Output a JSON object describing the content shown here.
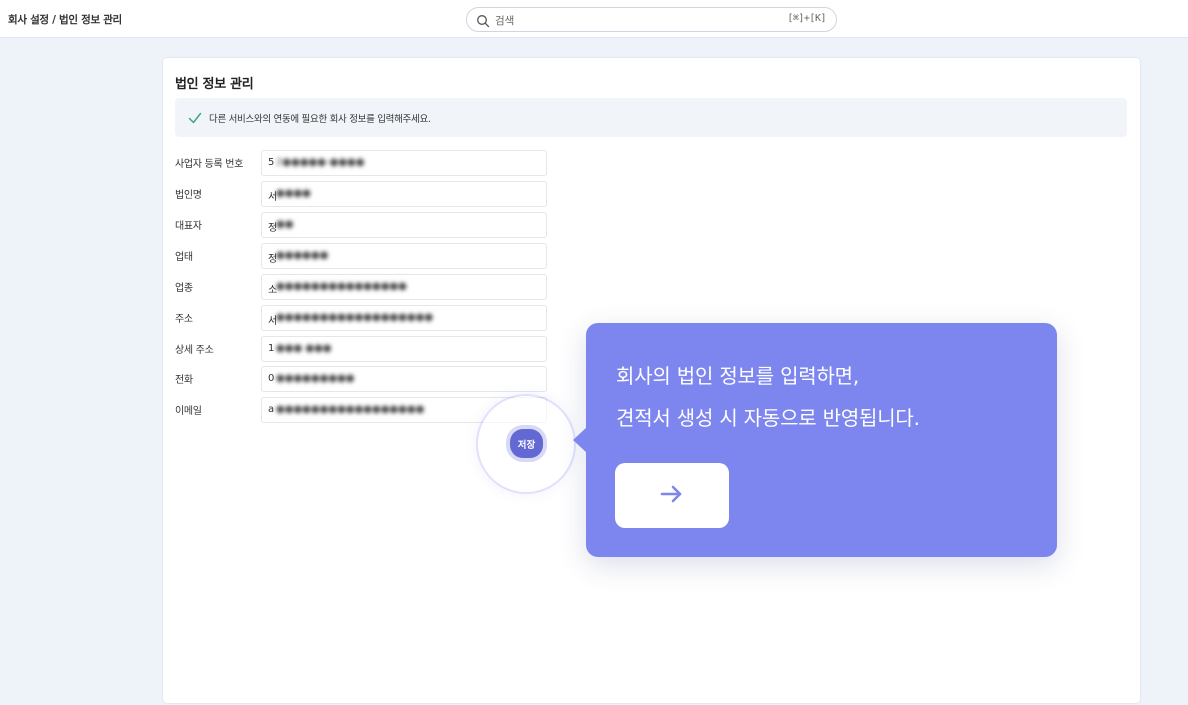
{
  "header": {
    "breadcrumb": "회사 설정 / 법인 정보 관리",
    "search": {
      "icon": "search-icon",
      "placeholder": "검색",
      "shortcut": "[⌘]+[K]"
    }
  },
  "main": {
    "title": "법인 정보 관리",
    "notice": {
      "icon": "check-icon",
      "text": "다른 서비스와의 연동에 필요한 회사 정보를 입력해주세요."
    },
    "fields": [
      {
        "label": "사업자 등록 번호",
        "first_char": "5",
        "value_obscured": "2●●●●●-●●●●"
      },
      {
        "label": "법인명",
        "first_char": "서",
        "value_obscured": "●●●●"
      },
      {
        "label": "대표자",
        "first_char": "정",
        "value_obscured": "●●"
      },
      {
        "label": "업태",
        "first_char": "정",
        "value_obscured": "●●●●●●"
      },
      {
        "label": "업종",
        "first_char": "소",
        "value_obscured": "●●●●●●●●●●●●●●●"
      },
      {
        "label": "주소",
        "first_char": "서",
        "value_obscured": "●●●●●●●●●●●●●●●●●●"
      },
      {
        "label": "상세 주소",
        "first_char": "1",
        "value_obscured": "●●● ●●●"
      },
      {
        "label": "전화",
        "first_char": "0",
        "value_obscured": "●●●●●●●●●"
      },
      {
        "label": "이메일",
        "first_char": "a",
        "value_obscured": "●●●●●●●●●●●●●●●●●"
      }
    ],
    "save_button": "저장"
  },
  "tooltip": {
    "line1": "회사의 법인 정보를 입력하면,",
    "line2": "견적서 생성 시 자동으로 반영됩니다.",
    "next_icon": "arrow-right-icon"
  },
  "colors": {
    "accent": "#7d86ee",
    "save_button": "#6268d4",
    "page_bg": "#eef3f9",
    "notice_bg": "#f1f5f9",
    "check": "#3aa58a"
  }
}
